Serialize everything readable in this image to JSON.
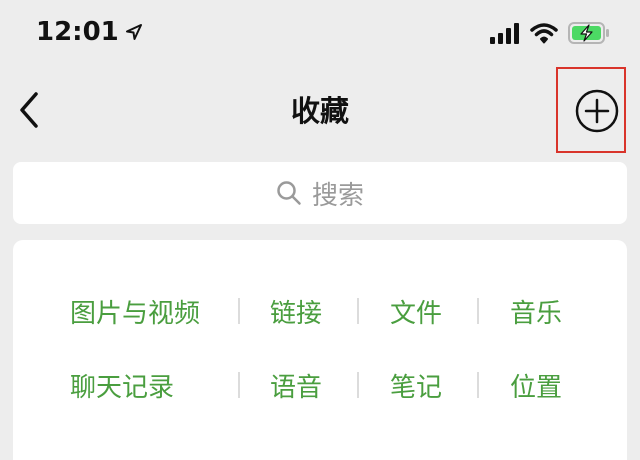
{
  "status_bar": {
    "time": "12:01",
    "icons": [
      "location-arrow-icon",
      "cellular-signal-icon",
      "wifi-icon",
      "battery-charging-icon"
    ],
    "battery_color": "#4cd964"
  },
  "nav": {
    "title": "收藏",
    "back_icon": "chevron-left-icon",
    "add_icon": "plus-circle-icon",
    "highlight_color": "#d9342b"
  },
  "search": {
    "placeholder": "搜索",
    "icon": "search-icon"
  },
  "categories": {
    "color": "#4a9e3f",
    "row1": [
      "图片与视频",
      "链接",
      "文件",
      "音乐"
    ],
    "row2": [
      "聊天记录",
      "语音",
      "笔记",
      "位置"
    ]
  }
}
